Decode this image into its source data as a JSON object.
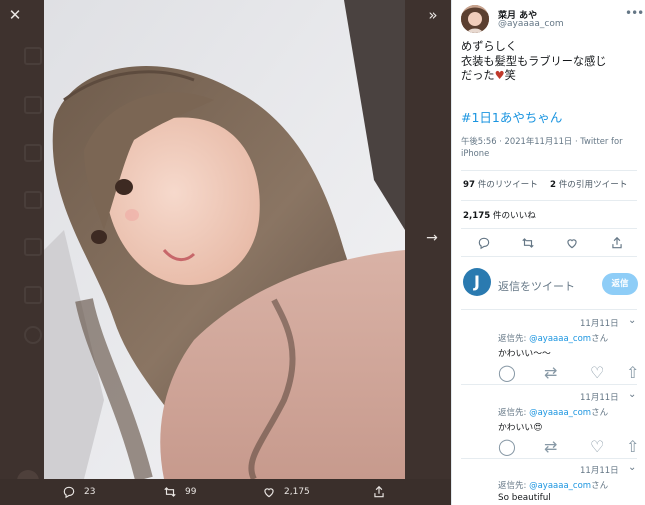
{
  "viewer": {
    "close_icon": "close-icon",
    "collapse_icon": "double-chevron-right-icon",
    "next_icon": "arrow-right-icon",
    "actions": {
      "reply_count": "23",
      "retweet_count": "99",
      "like_count": "2,175"
    }
  },
  "tweet": {
    "display_name": "菜月 あや",
    "handle": "@ayaaaa_com",
    "body_lines": [
      "めずらしく",
      "衣装も髪型もラブリーな感じ",
      "だった"
    ],
    "body_suffix": "笑",
    "hashtag": "#1日1あやちゃん",
    "timestamp": "午後5:56 · 2021年11月11日 · Twitter for iPhone",
    "retweets": {
      "count": "97",
      "label": " 件のリツイート"
    },
    "quotes": {
      "count": "2",
      "label": " 件の引用ツイート"
    },
    "likes": {
      "count": "2,175",
      "label": " 件のいいね"
    }
  },
  "compose": {
    "avatar_letter": "J",
    "placeholder": "返信をツイート",
    "button": "返信"
  },
  "replies": [
    {
      "time": "11月11日",
      "to_prefix": "返信先: ",
      "to_user": "@ayaaaa_com",
      "to_suffix": "さん",
      "text": "かわいい〜〜"
    },
    {
      "time": "11月11日",
      "to_prefix": "返信先: ",
      "to_user": "@ayaaaa_com",
      "to_suffix": "さん",
      "text": "かわいい😍"
    },
    {
      "time": "11月11日",
      "to_prefix": "返信先: ",
      "to_user": "@ayaaaa_com",
      "to_suffix": "さん",
      "text": "So beautiful"
    }
  ],
  "colors": {
    "accent": "#1b95e0",
    "viewer_bg": "#3e322e",
    "reply_button": "#8ecdf7"
  }
}
